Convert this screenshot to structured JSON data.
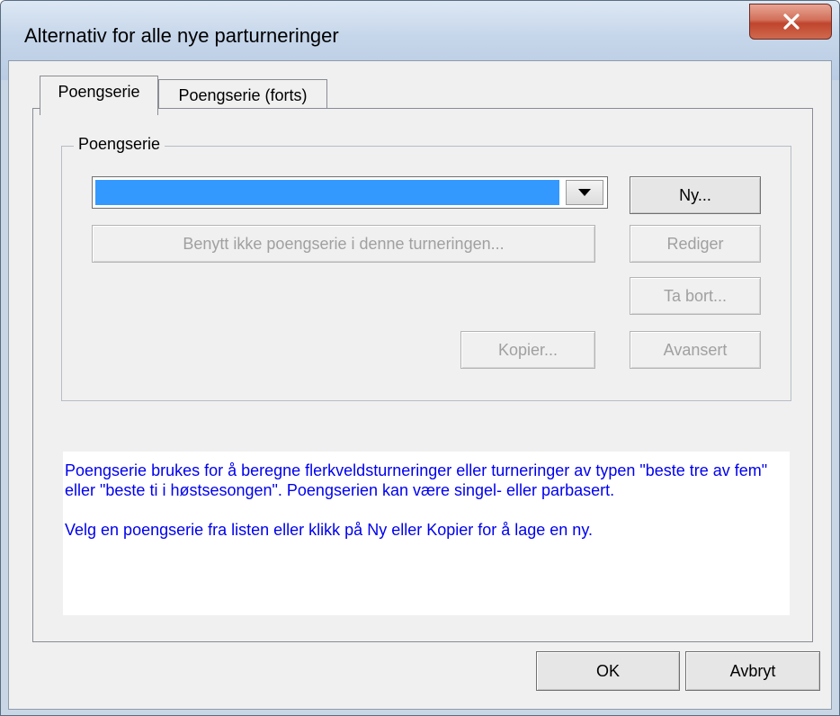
{
  "window": {
    "title": "Alternativ for alle nye parturneringer",
    "close_icon": "close-icon"
  },
  "tabs": [
    {
      "label": "Poengserie",
      "active": true
    },
    {
      "label": "Poengserie (forts)",
      "active": false
    }
  ],
  "group": {
    "label": "Poengserie",
    "dropdown": {
      "selected_value": "",
      "arrow_icon": "chevron-down-icon"
    },
    "buttons": {
      "new": "Ny...",
      "do_not_use": "Benytt ikke poengserie i denne turneringen...",
      "edit": "Rediger",
      "delete": "Ta bort...",
      "copy": "Kopier...",
      "advanced": "Avansert"
    }
  },
  "info": {
    "paragraph1": "Poengserie brukes for å beregne flerkveldsturneringer eller turneringer av typen \"beste tre av fem\" eller \"beste ti i høstsesongen\". Poengserien kan være singel- eller parbasert.",
    "paragraph2": "Velg en poengserie fra listen eller klikk på Ny eller Kopier for å lage en ny."
  },
  "footer": {
    "ok": "OK",
    "cancel": "Avbryt"
  },
  "colors": {
    "selection": "#3399ff",
    "info_text": "#0000ee"
  }
}
